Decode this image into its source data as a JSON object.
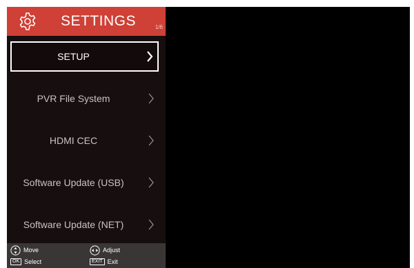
{
  "header": {
    "title": "SETTINGS",
    "page_indicator": "1/6",
    "icon": "gear-icon",
    "background_color": "#cf4036"
  },
  "menu": {
    "selected_index": 0,
    "items": [
      {
        "label": "SETUP",
        "icon": "chevron-right-icon"
      },
      {
        "label": "PVR File System",
        "icon": "chevron-right-icon"
      },
      {
        "label": "HDMI CEC",
        "icon": "chevron-right-icon"
      },
      {
        "label": "Software Update (USB)",
        "icon": "chevron-right-icon"
      },
      {
        "label": "Software Update (NET)",
        "icon": "chevron-right-icon"
      }
    ]
  },
  "footer": {
    "hints": [
      {
        "icon": "up-down-arrows-icon",
        "label": "Move"
      },
      {
        "icon": "left-right-arrows-icon",
        "label": "Adjust"
      },
      {
        "key": "OK",
        "label": "Select"
      },
      {
        "key": "EXIT",
        "label": "Exit"
      }
    ]
  }
}
